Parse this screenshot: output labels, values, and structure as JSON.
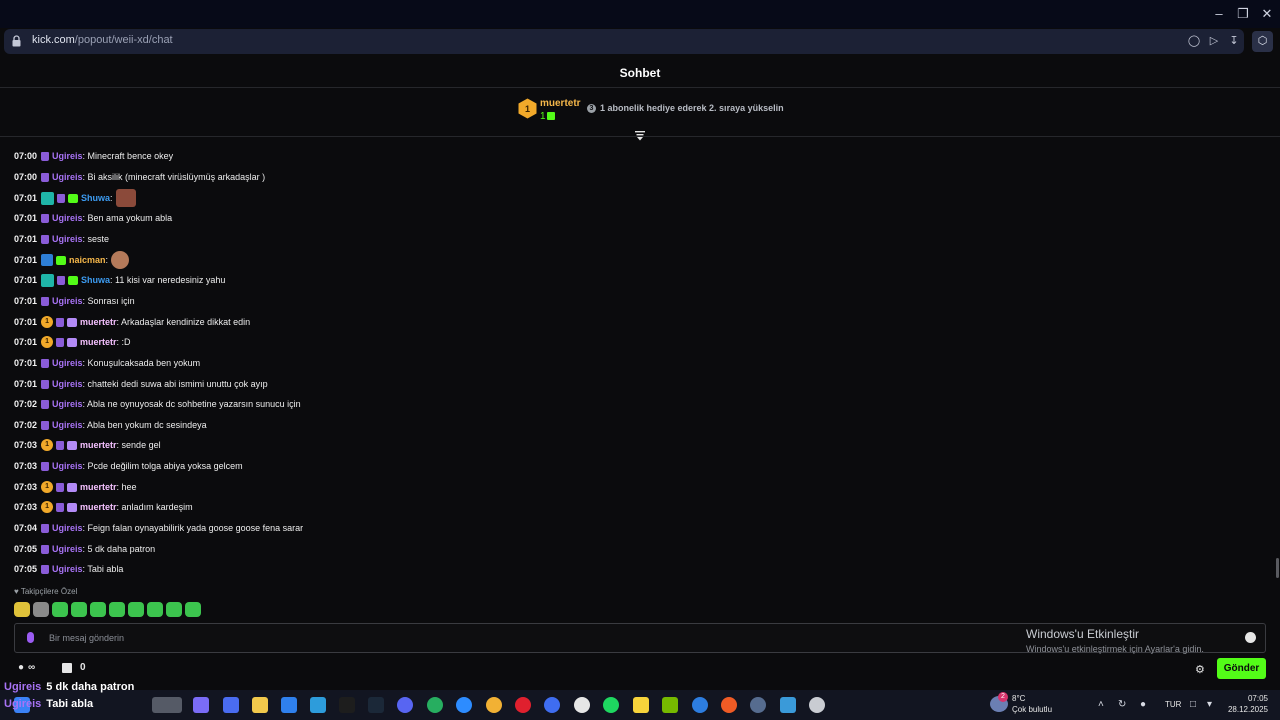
{
  "browser": {
    "url_host": "kick.com",
    "url_path": "/popout/weii-xd/chat"
  },
  "page": {
    "title": "Sohbet",
    "pinned": {
      "user": "muertetr",
      "rank": "1",
      "count": "1",
      "info_icon": "3",
      "text": "1 abonelik hediye ederek 2. sıraya yükselin"
    }
  },
  "chat": {
    "messages": [
      {
        "time": "07:00",
        "user": "Ugireis",
        "text": ": Minecraft bence okey"
      },
      {
        "time": "07:00",
        "user": "Ugireis",
        "text": ": Bi aksilik (minecraft virüslüymüş arkadaşlar )"
      },
      {
        "time": "07:01",
        "user": "Shuwa",
        "text": ":"
      },
      {
        "time": "07:01",
        "user": "Ugireis",
        "text": ": Ben ama yokum abla"
      },
      {
        "time": "07:01",
        "user": "Ugireis",
        "text": ": seste"
      },
      {
        "time": "07:01",
        "user": "naicman",
        "text": ":"
      },
      {
        "time": "07:01",
        "user": "Shuwa",
        "text": ": 11 kisi var neredesiniz yahu"
      },
      {
        "time": "07:01",
        "user": "Ugireis",
        "text": ": Sonrası için"
      },
      {
        "time": "07:01",
        "user": "muertetr",
        "text": ": Arkadaşlar kendinize dikkat edin"
      },
      {
        "time": "07:01",
        "user": "muertetr",
        "text": ": :D"
      },
      {
        "time": "07:01",
        "user": "Ugireis",
        "text": ": Konuşulcaksada ben yokum"
      },
      {
        "time": "07:01",
        "user": "Ugireis",
        "text": ": chatteki dedi suwa abi ismimi unuttu çok ayıp"
      },
      {
        "time": "07:02",
        "user": "Ugireis",
        "text": ": Abla ne oynuyosak dc sohbetine yazarsın sunucu için"
      },
      {
        "time": "07:02",
        "user": "Ugireis",
        "text": ": Abla ben yokum dc sesindeya"
      },
      {
        "time": "07:03",
        "user": "muertetr",
        "text": ": sende gel"
      },
      {
        "time": "07:03",
        "user": "Ugireis",
        "text": ": Pcde değilim tolga abiya yoksa gelcem"
      },
      {
        "time": "07:03",
        "user": "muertetr",
        "text": ": hee"
      },
      {
        "time": "07:03",
        "user": "muertetr",
        "text": ": anladım kardeşim"
      },
      {
        "time": "07:04",
        "user": "Ugireis",
        "text": ": Feign falan oynayabilirik yada goose goose fena sarar"
      },
      {
        "time": "07:05",
        "user": "Ugireis",
        "text": ": 5 dk daha patron"
      },
      {
        "time": "07:05",
        "user": "Ugireis",
        "text": ": Tabi abla"
      }
    ],
    "rank_badge": "1",
    "followers_label": "Takipçilere Özel",
    "input_placeholder": "Bir mesaj gönderin",
    "points": "∞",
    "inventory_count": "0",
    "send_label": "Gönder"
  },
  "activation": {
    "title": "Windows'u Etkinleştir",
    "subtitle": "Windows'u etkinleştirmek için Ayarlar'a gidin."
  },
  "overlay": [
    {
      "user": "Ugireis",
      "text": "5 dk daha patron"
    },
    {
      "user": "Ugireis",
      "text": "Tabi abla"
    }
  ],
  "taskbar": {
    "weather_badge": "2",
    "temp": "8°C",
    "weather": "Çok bulutlu",
    "lang": "TUR",
    "time": "07:05",
    "date": "28.12.2025"
  },
  "colors": {
    "accent": "#53fc18",
    "username_purple": "#a873f5",
    "username_blue": "#3c9bf1",
    "username_gold": "#f5b74a",
    "background": "#0b0b0d"
  }
}
